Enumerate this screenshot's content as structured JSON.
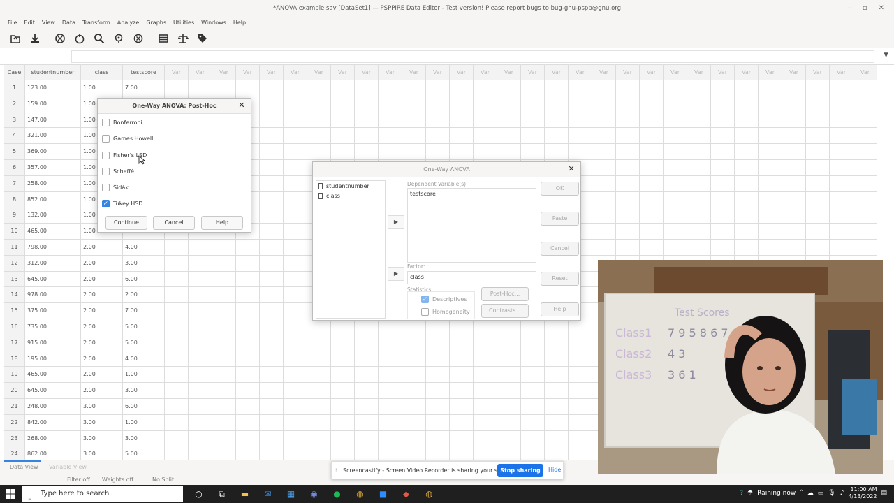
{
  "window": {
    "title": "*ANOVA example.sav [DataSet1] — PSPPIRE Data Editor - Test version! Please report bugs to bug-gnu-pspp@gnu.org",
    "min": "–",
    "max": "▫",
    "close": "✕"
  },
  "menu": [
    "File",
    "Edit",
    "View",
    "Data",
    "Transform",
    "Analyze",
    "Graphs",
    "Utilities",
    "Windows",
    "Help"
  ],
  "toolbar": [
    "open-icon",
    "save-icon",
    "goto-case-icon",
    "goto-variable-icon",
    "find-icon",
    "insert-case-icon",
    "insert-variable-icon",
    "split-file-icon",
    "weight-cases-icon",
    "value-labels-icon"
  ],
  "grid": {
    "headers": [
      "Case",
      "studentnumber",
      "class",
      "testscore"
    ],
    "var_label": "Var",
    "var_count": 30,
    "rows": [
      [
        "1",
        "123.00",
        "1.00",
        "7.00"
      ],
      [
        "2",
        "159.00",
        "1.00",
        ""
      ],
      [
        "3",
        "147.00",
        "1.00",
        ""
      ],
      [
        "4",
        "321.00",
        "1.00",
        ""
      ],
      [
        "5",
        "369.00",
        "1.00",
        ""
      ],
      [
        "6",
        "357.00",
        "1.00",
        ""
      ],
      [
        "7",
        "258.00",
        "1.00",
        ""
      ],
      [
        "8",
        "852.00",
        "1.00",
        ""
      ],
      [
        "9",
        "132.00",
        "1.00",
        ""
      ],
      [
        "10",
        "465.00",
        "1.00",
        ""
      ],
      [
        "11",
        "798.00",
        "2.00",
        "4.00"
      ],
      [
        "12",
        "312.00",
        "2.00",
        "3.00"
      ],
      [
        "13",
        "645.00",
        "2.00",
        "6.00"
      ],
      [
        "14",
        "978.00",
        "2.00",
        "2.00"
      ],
      [
        "15",
        "375.00",
        "2.00",
        "7.00"
      ],
      [
        "16",
        "735.00",
        "2.00",
        "5.00"
      ],
      [
        "17",
        "915.00",
        "2.00",
        "5.00"
      ],
      [
        "18",
        "195.00",
        "2.00",
        "4.00"
      ],
      [
        "19",
        "465.00",
        "2.00",
        "1.00"
      ],
      [
        "20",
        "645.00",
        "2.00",
        "3.00"
      ],
      [
        "21",
        "248.00",
        "3.00",
        "6.00"
      ],
      [
        "22",
        "842.00",
        "3.00",
        "1.00"
      ],
      [
        "23",
        "268.00",
        "3.00",
        "3.00"
      ],
      [
        "24",
        "862.00",
        "3.00",
        "5.00"
      ]
    ]
  },
  "bottom": {
    "data_view": "Data View",
    "variable_view": "Variable View"
  },
  "status": {
    "filter": "Filter off",
    "weights": "Weights off",
    "split": "No Split"
  },
  "posthoc": {
    "title": "One-Way ANOVA: Post-Hoc",
    "options": [
      {
        "label": "Bonferroni",
        "checked": false
      },
      {
        "label": "Games Howell",
        "checked": false
      },
      {
        "label": "Fisher's LSD",
        "checked": false
      },
      {
        "label": "Scheffé",
        "checked": false
      },
      {
        "label": "Šidák",
        "checked": false
      },
      {
        "label": "Tukey HSD",
        "checked": true
      }
    ],
    "continue": "Continue",
    "cancel": "Cancel",
    "help": "Help"
  },
  "oneway": {
    "title": "One-Way ANOVA",
    "variables": [
      "studentnumber",
      "class"
    ],
    "dependent_label": "Dependent Variable(s):",
    "dependent_value": "testscore",
    "factor_label": "Factor:",
    "factor_value": "class",
    "statistics_label": "Statistics",
    "descriptives": "Descriptives",
    "homogeneity": "Homogeneity",
    "posthoc_btn": "Post-Hoc...",
    "contrasts_btn": "Contrasts...",
    "ok": "OK",
    "paste": "Paste",
    "cancel": "Cancel",
    "reset": "Reset",
    "help": "Help"
  },
  "webcam": {
    "board_title": "Test Scores",
    "row1": "Class1",
    "row2": "Class2",
    "row3": "Class3"
  },
  "share": {
    "text": "Screencastify - Screen Video Recorder is sharing your screen.",
    "stop": "Stop sharing",
    "hide": "Hide"
  },
  "taskbar": {
    "search_placeholder": "Type here to search",
    "weather": "Raining now",
    "time": "11:00 AM",
    "date": "4/13/2022"
  }
}
